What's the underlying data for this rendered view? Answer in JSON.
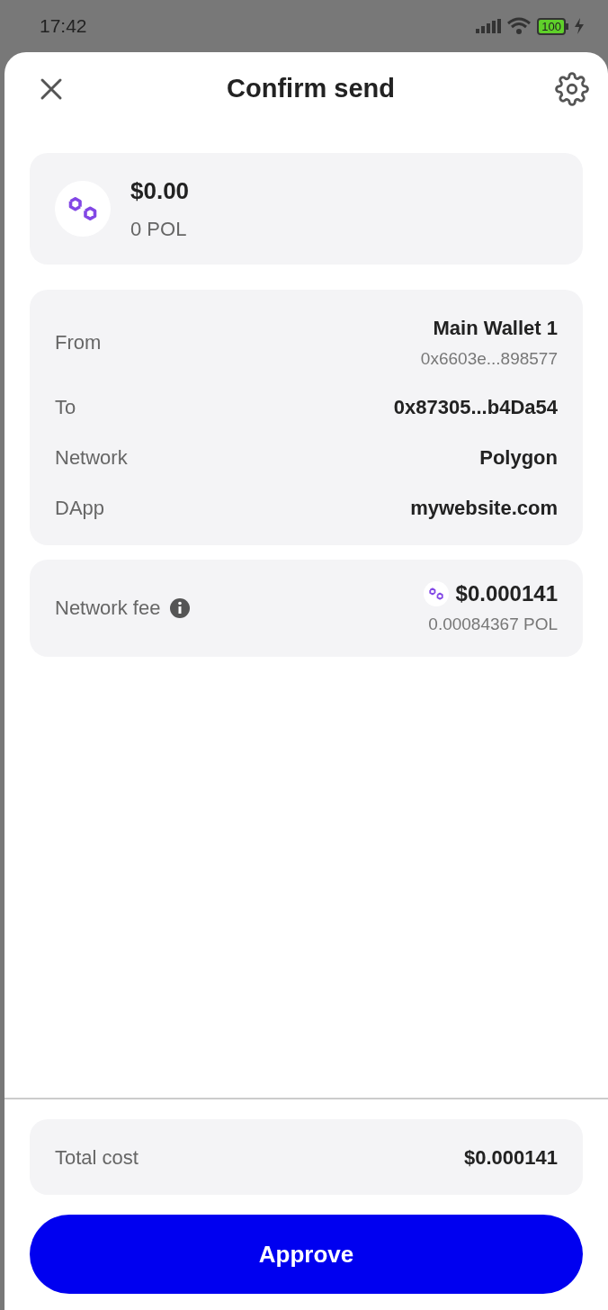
{
  "status_bar": {
    "time": "17:42",
    "battery": "100"
  },
  "header": {
    "title": "Confirm send"
  },
  "asset": {
    "amount_usd": "$0.00",
    "amount_token": "0 POL"
  },
  "details": [
    {
      "label": "From",
      "value": "Main Wallet 1",
      "subvalue": "0x6603e...898577"
    },
    {
      "label": "To",
      "value": "0x87305...b4Da54"
    },
    {
      "label": "Network",
      "value": "Polygon"
    },
    {
      "label": "DApp",
      "value": "mywebsite.com"
    }
  ],
  "fee": {
    "label": "Network fee",
    "value_usd": "$0.000141",
    "value_token": "0.00084367 POL"
  },
  "total": {
    "label": "Total cost",
    "value": "$0.000141"
  },
  "approve_button": "Approve"
}
